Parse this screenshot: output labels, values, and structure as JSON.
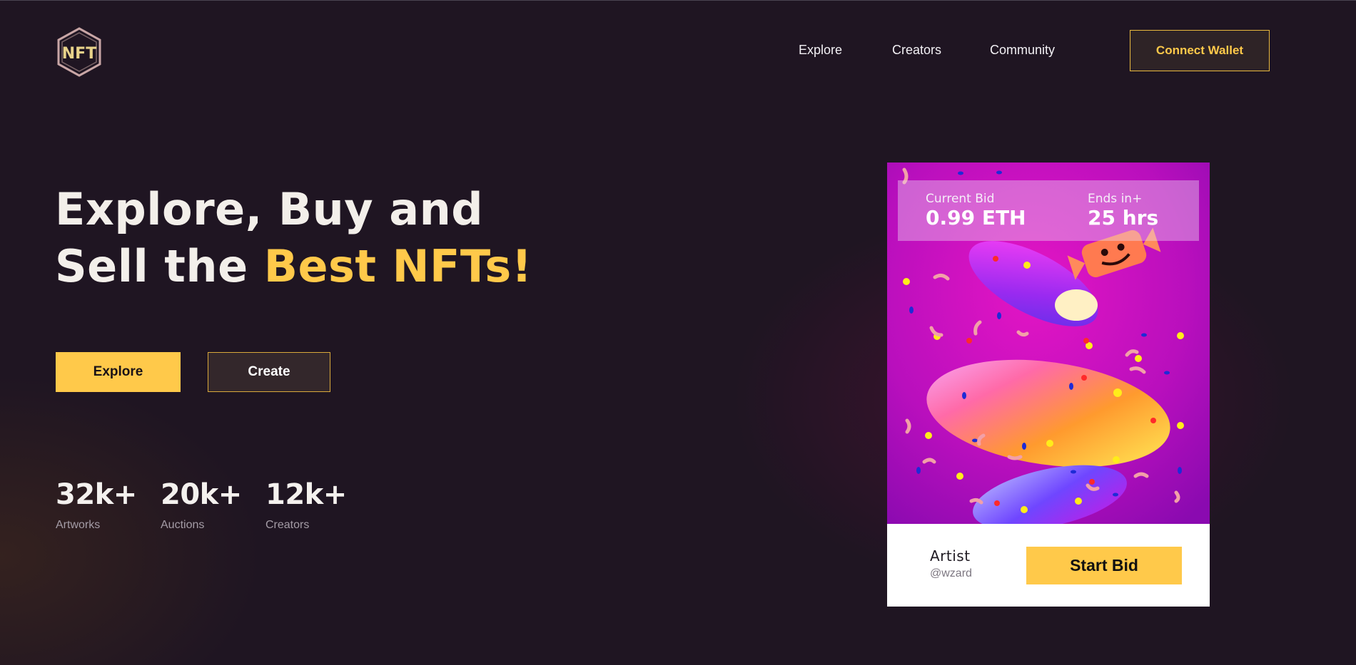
{
  "brand": {
    "logo_text": "NFT"
  },
  "nav": {
    "links": [
      "Explore",
      "Creators",
      "Community"
    ],
    "wallet_button": "Connect Wallet"
  },
  "hero": {
    "title_line1": "Explore, Buy and",
    "title_line2_prefix": "Sell the ",
    "title_line2_highlight": "Best NFTs!",
    "explore_button": "Explore",
    "create_button": "Create"
  },
  "stats": [
    {
      "value": "32k+",
      "label": "Artworks"
    },
    {
      "value": "20k+",
      "label": "Auctions"
    },
    {
      "value": "12k+",
      "label": "Creators"
    }
  ],
  "card": {
    "current_bid_label": "Current Bid",
    "current_bid_value": "0.99 ETH",
    "ends_label": "Ends in+",
    "ends_value": "25 hrs",
    "artist_label": "Artist",
    "artist_handle": "@wzard",
    "bid_button": "Start Bid"
  },
  "colors": {
    "accent": "#ffc94a",
    "background": "#1f1522",
    "card_art": "#b40fbf"
  }
}
